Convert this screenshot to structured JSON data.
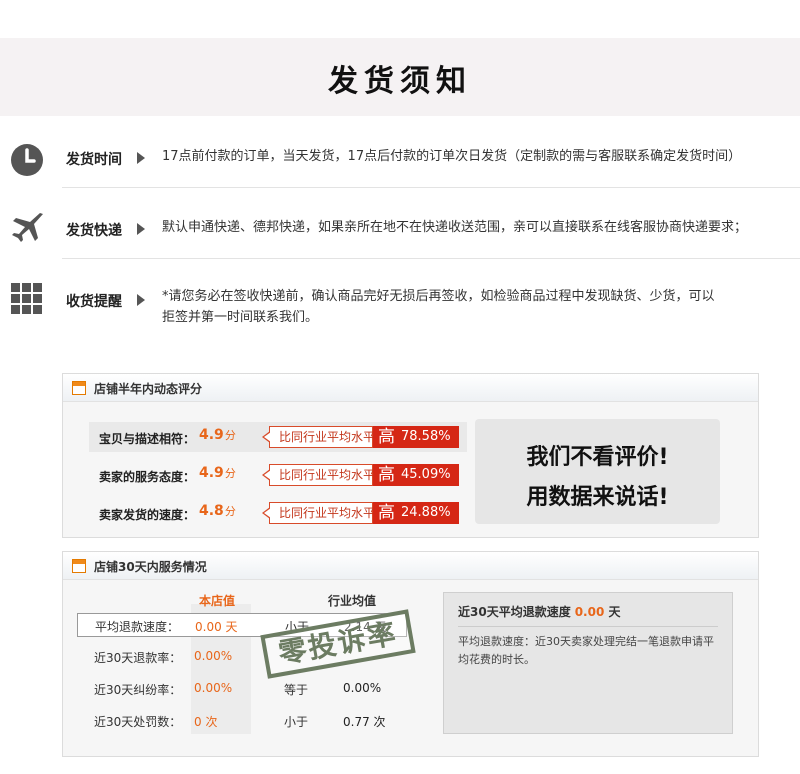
{
  "header": {
    "title": "发货须知"
  },
  "info": [
    {
      "icon": "clock-icon",
      "label": "发货时间",
      "text": [
        "17点前付款的订单，当天发货，17点后付款的订单次日发货（定制款的需与客服联系确定发货时间）"
      ]
    },
    {
      "icon": "airplane-icon",
      "label": "发货快递",
      "text": [
        "默认申通快递、德邦快递，如果亲所在地不在快递收送范围，亲可以直接联系在线客服协商快递要求；"
      ]
    },
    {
      "icon": "grid-icon",
      "label": "收货提醒",
      "text": [
        "*请您务必在签收快递前，确认商品完好无损后再签收，如检验商品过程中发现缺货、少货，可以",
        "拒签并第一时间联系我们。"
      ]
    }
  ],
  "rating": {
    "title": "店铺半年内动态评分",
    "compare_label": "比同行业平均水平",
    "high_label": "高",
    "unit": "分",
    "rows": [
      {
        "label": "宝贝与描述相符：",
        "score": "4.9",
        "percent": "78.58%"
      },
      {
        "label": "卖家的服务态度：",
        "score": "4.9",
        "percent": "45.09%"
      },
      {
        "label": "卖家发货的速度：",
        "score": "4.8",
        "percent": "24.88%"
      }
    ],
    "slogan": [
      "我们不看评价!",
      "用数据来说话!"
    ]
  },
  "service": {
    "title": "店铺30天内服务情况",
    "col_shop": "本店值",
    "col_industry": "行业均值",
    "rows": [
      {
        "label": "平均退款速度：",
        "shop": "0.00 天",
        "compare": "小于",
        "industry": "2.14 天"
      },
      {
        "label": "近30天退款率：",
        "shop": "0.00%",
        "compare": "",
        "industry": ""
      },
      {
        "label": "近30天纠纷率：",
        "shop": "0.00%",
        "compare": "等于",
        "industry": "0.00%"
      },
      {
        "label": "近30天处罚数：",
        "shop": "0 次",
        "compare": "小于",
        "industry": "0.77 次"
      }
    ],
    "stamp": "零投诉率",
    "detail": {
      "title": "近30天平均退款速度",
      "value": "0.00",
      "unit": "天",
      "text": "平均退款速度：近30天卖家处理完结一笔退款申请平均花费的时长。"
    }
  },
  "colors": {
    "accent": "#e8661a",
    "badge_red": "#d52715"
  }
}
